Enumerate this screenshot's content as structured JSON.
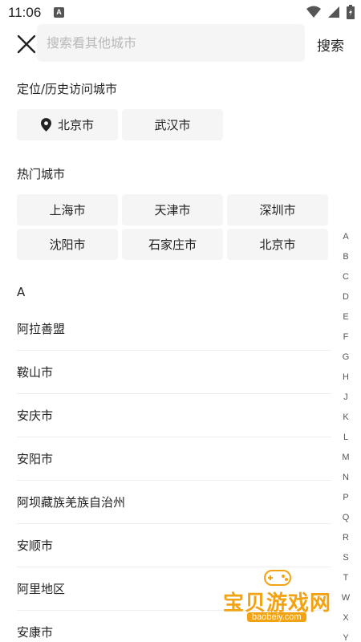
{
  "status_bar": {
    "time": "11:06",
    "notification_letter": "A"
  },
  "search": {
    "placeholder": "搜索看其他城市",
    "search_label": "搜索"
  },
  "location_section": {
    "title": "定位/历史访问城市",
    "current": "北京市",
    "history": [
      "武汉市"
    ]
  },
  "hot_section": {
    "title": "热门城市",
    "cities": [
      "上海市",
      "天津市",
      "深圳市",
      "沈阳市",
      "石家庄市",
      "北京市"
    ]
  },
  "list": {
    "letter": "A",
    "cities": [
      "阿拉善盟",
      "鞍山市",
      "安庆市",
      "安阳市",
      "阿坝藏族羌族自治州",
      "安顺市",
      "阿里地区",
      "安康市"
    ]
  },
  "index_letters": [
    "A",
    "B",
    "C",
    "D",
    "E",
    "F",
    "G",
    "H",
    "J",
    "K",
    "L",
    "M",
    "N",
    "P",
    "Q",
    "R",
    "S",
    "T",
    "W",
    "X",
    "Y"
  ],
  "watermark": {
    "brand": "宝贝游戏网",
    "site": "baobeiy.com"
  },
  "colors": {
    "chip_bg": "#f5f5f5",
    "watermark": "#f2a313"
  }
}
